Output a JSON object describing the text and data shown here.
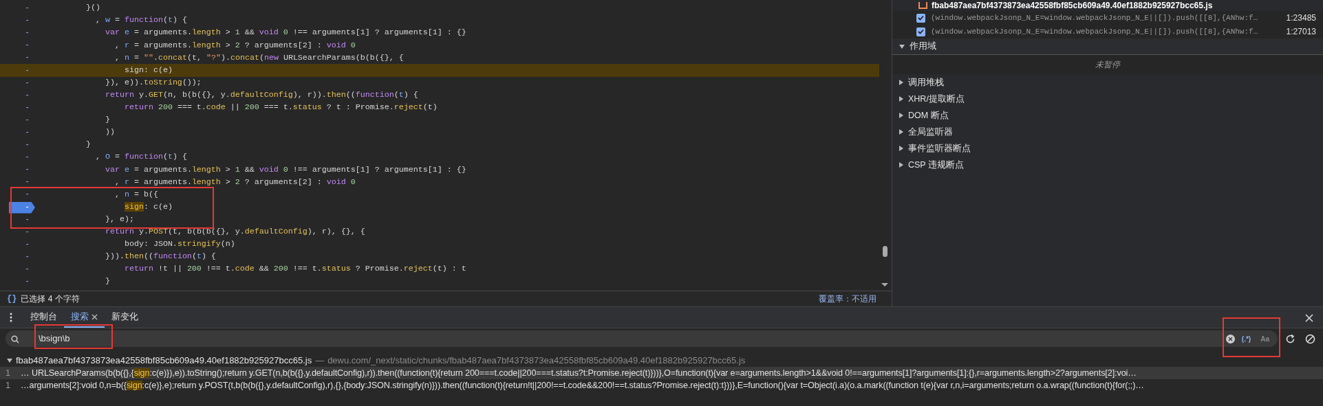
{
  "code_editor": {
    "lines": [
      {
        "gutter": "-",
        "tokens": [
          {
            "kind": "p",
            "text": "         }()"
          }
        ]
      },
      {
        "gutter": "-",
        "tokens": [
          {
            "kind": "p",
            "text": "           , "
          },
          {
            "kind": "v",
            "text": "w"
          },
          {
            "kind": "p",
            "text": " = "
          },
          {
            "kind": "k",
            "text": "function"
          },
          {
            "kind": "p",
            "text": "("
          },
          {
            "kind": "v",
            "text": "t"
          },
          {
            "kind": "p",
            "text": ") {"
          }
        ]
      },
      {
        "gutter": "-",
        "tokens": [
          {
            "kind": "k",
            "text": "             var"
          },
          {
            "kind": "v",
            "text": " e"
          },
          {
            "kind": "p",
            "text": " = arguments."
          },
          {
            "kind": "m",
            "text": "length"
          },
          {
            "kind": "p",
            "text": " > "
          },
          {
            "kind": "n",
            "text": "1"
          },
          {
            "kind": "p",
            "text": " && "
          },
          {
            "kind": "k",
            "text": "void"
          },
          {
            "kind": "n",
            "text": " 0"
          },
          {
            "kind": "p",
            "text": " !== arguments[1] ? arguments[1] : {}"
          }
        ]
      },
      {
        "gutter": "-",
        "tokens": [
          {
            "kind": "p",
            "text": "               , "
          },
          {
            "kind": "v",
            "text": "r"
          },
          {
            "kind": "p",
            "text": " = arguments."
          },
          {
            "kind": "m",
            "text": "length"
          },
          {
            "kind": "p",
            "text": " > "
          },
          {
            "kind": "n",
            "text": "2"
          },
          {
            "kind": "p",
            "text": " ? arguments[2] : "
          },
          {
            "kind": "k",
            "text": "void"
          },
          {
            "kind": "n",
            "text": " 0"
          }
        ]
      },
      {
        "gutter": "-",
        "tokens": [
          {
            "kind": "p",
            "text": "               , "
          },
          {
            "kind": "v",
            "text": "n"
          },
          {
            "kind": "p",
            "text": " = "
          },
          {
            "kind": "s",
            "text": "\"\""
          },
          {
            "kind": "p",
            "text": "."
          },
          {
            "kind": "m",
            "text": "concat"
          },
          {
            "kind": "p",
            "text": "(t, "
          },
          {
            "kind": "s",
            "text": "\"?\""
          },
          {
            "kind": "p",
            "text": ")."
          },
          {
            "kind": "m",
            "text": "concat"
          },
          {
            "kind": "p",
            "text": "("
          },
          {
            "kind": "k",
            "text": "new"
          },
          {
            "kind": "p",
            "text": " URLSearchParams(b(b({}, {"
          }
        ]
      },
      {
        "gutter": "-",
        "highlighted": true,
        "tokens": [
          {
            "kind": "p",
            "text": "                 sign: c(e)"
          }
        ]
      },
      {
        "gutter": "-",
        "tokens": [
          {
            "kind": "p",
            "text": "             }), e))."
          },
          {
            "kind": "m",
            "text": "toString"
          },
          {
            "kind": "p",
            "text": "());"
          }
        ]
      },
      {
        "gutter": "-",
        "tokens": [
          {
            "kind": "k",
            "text": "             return"
          },
          {
            "kind": "p",
            "text": " y."
          },
          {
            "kind": "m",
            "text": "GET"
          },
          {
            "kind": "p",
            "text": "(n, b(b({}, y."
          },
          {
            "kind": "m",
            "text": "defaultConfig"
          },
          {
            "kind": "p",
            "text": "), r))."
          },
          {
            "kind": "m",
            "text": "then"
          },
          {
            "kind": "p",
            "text": "(("
          },
          {
            "kind": "k",
            "text": "function"
          },
          {
            "kind": "p",
            "text": "("
          },
          {
            "kind": "v",
            "text": "t"
          },
          {
            "kind": "p",
            "text": ") {"
          }
        ]
      },
      {
        "gutter": "-",
        "tokens": [
          {
            "kind": "k",
            "text": "                 return"
          },
          {
            "kind": "n",
            "text": " 200"
          },
          {
            "kind": "p",
            "text": " === t."
          },
          {
            "kind": "m",
            "text": "code"
          },
          {
            "kind": "p",
            "text": " || "
          },
          {
            "kind": "n",
            "text": "200"
          },
          {
            "kind": "p",
            "text": " === t."
          },
          {
            "kind": "m",
            "text": "status"
          },
          {
            "kind": "p",
            "text": " ? t : Promise."
          },
          {
            "kind": "m",
            "text": "reject"
          },
          {
            "kind": "p",
            "text": "(t)"
          }
        ]
      },
      {
        "gutter": "-",
        "tokens": [
          {
            "kind": "p",
            "text": "             }"
          }
        ]
      },
      {
        "gutter": "-",
        "tokens": [
          {
            "kind": "p",
            "text": "             ))"
          }
        ]
      },
      {
        "gutter": "-",
        "tokens": [
          {
            "kind": "p",
            "text": "         }"
          }
        ]
      },
      {
        "gutter": "-",
        "tokens": [
          {
            "kind": "p",
            "text": "           , "
          },
          {
            "kind": "v",
            "text": "O"
          },
          {
            "kind": "p",
            "text": " = "
          },
          {
            "kind": "k",
            "text": "function"
          },
          {
            "kind": "p",
            "text": "("
          },
          {
            "kind": "v",
            "text": "t"
          },
          {
            "kind": "p",
            "text": ") {"
          }
        ]
      },
      {
        "gutter": "-",
        "tokens": [
          {
            "kind": "k",
            "text": "             var"
          },
          {
            "kind": "v",
            "text": " e"
          },
          {
            "kind": "p",
            "text": " = arguments."
          },
          {
            "kind": "m",
            "text": "length"
          },
          {
            "kind": "p",
            "text": " > "
          },
          {
            "kind": "n",
            "text": "1"
          },
          {
            "kind": "p",
            "text": " && "
          },
          {
            "kind": "k",
            "text": "void"
          },
          {
            "kind": "n",
            "text": " 0"
          },
          {
            "kind": "p",
            "text": " !== arguments[1] ? arguments[1] : {}"
          }
        ]
      },
      {
        "gutter": "-",
        "tokens": [
          {
            "kind": "p",
            "text": "               , "
          },
          {
            "kind": "v",
            "text": "r"
          },
          {
            "kind": "p",
            "text": " = arguments."
          },
          {
            "kind": "m",
            "text": "length"
          },
          {
            "kind": "p",
            "text": " > "
          },
          {
            "kind": "n",
            "text": "2"
          },
          {
            "kind": "p",
            "text": " ? arguments[2] : "
          },
          {
            "kind": "k",
            "text": "void"
          },
          {
            "kind": "n",
            "text": " 0"
          }
        ]
      },
      {
        "gutter": "-",
        "boxed": true,
        "tokens": [
          {
            "kind": "p",
            "text": "               , "
          },
          {
            "kind": "v",
            "text": "n"
          },
          {
            "kind": "p",
            "text": " = b({"
          }
        ]
      },
      {
        "gutter": "-",
        "boxed": true,
        "breakpoint": true,
        "tokens": [
          {
            "kind": "h",
            "text": "                 sign"
          },
          {
            "kind": "p",
            "text": ": c(e)"
          }
        ]
      },
      {
        "gutter": "-",
        "boxed": true,
        "tokens": [
          {
            "kind": "p",
            "text": "             }, e);"
          }
        ]
      },
      {
        "gutter": "-",
        "tokens": [
          {
            "kind": "k",
            "text": "             return"
          },
          {
            "kind": "p",
            "text": " y."
          },
          {
            "kind": "m",
            "text": "POST"
          },
          {
            "kind": "p",
            "text": "(t, b(b(b({}, y."
          },
          {
            "kind": "m",
            "text": "defaultConfig"
          },
          {
            "kind": "p",
            "text": "), r), {}, {"
          }
        ]
      },
      {
        "gutter": "-",
        "tokens": [
          {
            "kind": "p",
            "text": "                 body: JSON."
          },
          {
            "kind": "m",
            "text": "stringify"
          },
          {
            "kind": "p",
            "text": "(n)"
          }
        ]
      },
      {
        "gutter": "-",
        "tokens": [
          {
            "kind": "p",
            "text": "             }))."
          },
          {
            "kind": "m",
            "text": "then"
          },
          {
            "kind": "p",
            "text": "(("
          },
          {
            "kind": "k",
            "text": "function"
          },
          {
            "kind": "p",
            "text": "("
          },
          {
            "kind": "v",
            "text": "t"
          },
          {
            "kind": "p",
            "text": ") {"
          }
        ]
      },
      {
        "gutter": "-",
        "tokens": [
          {
            "kind": "k",
            "text": "                 return"
          },
          {
            "kind": "p",
            "text": " !t || "
          },
          {
            "kind": "n",
            "text": "200"
          },
          {
            "kind": "p",
            "text": " !== t."
          },
          {
            "kind": "m",
            "text": "code"
          },
          {
            "kind": "p",
            "text": " && "
          },
          {
            "kind": "n",
            "text": "200"
          },
          {
            "kind": "p",
            "text": " !== t."
          },
          {
            "kind": "m",
            "text": "status"
          },
          {
            "kind": "p",
            "text": " ? Promise."
          },
          {
            "kind": "m",
            "text": "reject"
          },
          {
            "kind": "p",
            "text": "(t) : t"
          }
        ]
      },
      {
        "gutter": "-",
        "tokens": [
          {
            "kind": "p",
            "text": "             }"
          }
        ]
      }
    ]
  },
  "status_bar": {
    "format_button": "{}",
    "selection": "已选择 4 个字符",
    "coverage": "覆盖率：不适用"
  },
  "sidebar": {
    "file": "fbab487aea7bf4373873ea42558fbf85cb609a49.40ef1882b925927bcc65.js",
    "breakpoints": [
      {
        "checked": true,
        "code": "(window.webpackJsonp_N_E=window.webpackJsonp_N_E||[]).push([[8],{ANhw:f…",
        "location": "1:23485"
      },
      {
        "checked": true,
        "code": "(window.webpackJsonp_N_E=window.webpackJsonp_N_E||[]).push([[8],{ANhw:f…",
        "location": "1:27013"
      }
    ],
    "sections": [
      {
        "title": "作用域",
        "expanded": true,
        "content": "未暂停"
      },
      {
        "title": "调用堆栈",
        "expanded": false
      },
      {
        "title": "XHR/提取断点",
        "expanded": false
      },
      {
        "title": "DOM 断点",
        "expanded": false
      },
      {
        "title": "全局监听器",
        "expanded": false
      },
      {
        "title": "事件监听器断点",
        "expanded": false
      },
      {
        "title": "CSP 违规断点",
        "expanded": false
      }
    ]
  },
  "drawer": {
    "tabs": [
      {
        "label": "控制台",
        "selected": false
      },
      {
        "label": "搜索",
        "selected": true,
        "closable": true
      },
      {
        "label": "新变化",
        "selected": false
      }
    ],
    "search": {
      "value": "\\bsign\\b",
      "boxed": true,
      "regex": true,
      "regex_label": "(.*)",
      "match_case": false,
      "case_label": "Aa"
    },
    "results": {
      "file": "fbab487aea7bf4373873ea42558fbf85cb609a49.40ef1882b925927bcc65.js",
      "separator": "—",
      "path": "dewu.com/_next/static/chunks/fbab487aea7bf4373873ea42558fbf85cb609a49.40ef1882b925927bcc65.js",
      "expanded": true,
      "matches": [
        {
          "line": "1",
          "selected": true,
          "before": "… URLSearchParams(b(b({},{",
          "match": "sign",
          "after": ":c(e)}),e)).toString();return y.GET(n,b(b({},y.defaultConfig),r)).then((function(t){return 200===t.code||200===t.status?t:Promise.reject(t)}))},O=function(t){var e=arguments.length>1&&void 0!==arguments[1]?arguments[1]:{},r=arguments.length>2?arguments[2]:voi…"
        },
        {
          "line": "1",
          "selected": false,
          "before": "…arguments[2]:void 0,n=b({",
          "match": "sign",
          "after": ":c(e)},e);return y.POST(t,b(b(b({},y.defaultConfig),r),{},{body:JSON.stringify(n)})).then((function(t){return!t||200!==t.code&&200!==t.status?Promise.reject(t):t}))},E=function(){var t=Object(i.a)(o.a.mark((function t(e){var r,n,i=arguments;return o.a.wrap((function(t){for(;;)…"
        }
      ]
    }
  }
}
